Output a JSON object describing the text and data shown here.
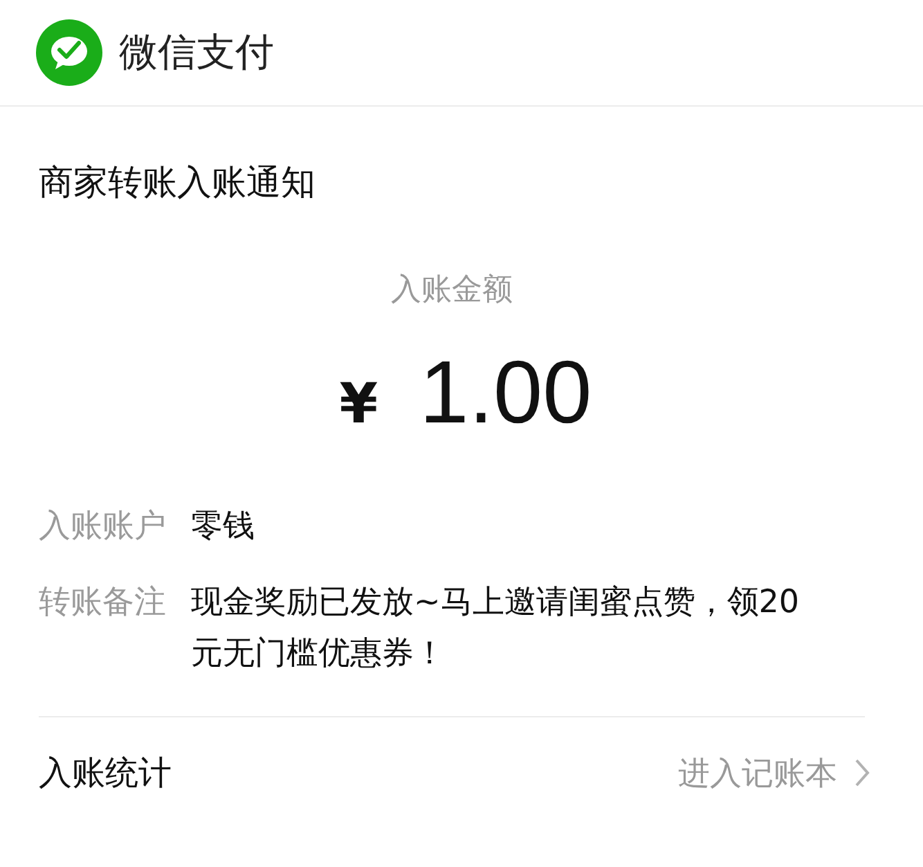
{
  "app": {
    "title": "微信支付"
  },
  "notice": {
    "title": "商家转账入账通知",
    "amount_label": "入账金额",
    "currency": "¥",
    "amount": "1.00",
    "fields": [
      {
        "label": "入账账户",
        "value": "零钱"
      },
      {
        "label": "转账备注",
        "value": "现金奖励已发放~马上邀请闺蜜点赞，领20元无门槛优惠券！"
      }
    ],
    "footer": {
      "label": "入账统计",
      "link": "进入记账本"
    }
  }
}
